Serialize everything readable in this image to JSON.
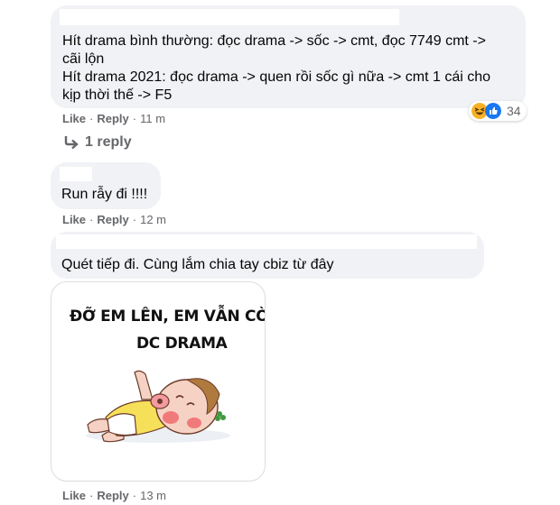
{
  "comments": [
    {
      "lines": [
        "Hít drama bình thường: đọc drama -> sốc -> cmt, đọc 7749 cmt ->",
        "cãi lộn",
        "Hít drama 2021: đọc drama -> quen rồi sốc gì nữa -> cmt 1 cái cho",
        "kịp thời thế -> F5"
      ],
      "like_label": "Like",
      "reply_label": "Reply",
      "time": "11 m",
      "reaction_count": "34"
    },
    {
      "text": "Run rẫy đi !!!!",
      "like_label": "Like",
      "reply_label": "Reply",
      "time": "12 m"
    },
    {
      "text": "Quét tiếp đi. Cùng lắm chia tay cbiz từ đây",
      "like_label": "Like",
      "reply_label": "Reply",
      "time": "13 m"
    }
  ],
  "replies_link": "1 reply",
  "separator": "·",
  "sticker": {
    "line1": "ĐỠ EM LÊN, EM VẪN CÒN HÍT",
    "line2": "DC DRAMA"
  },
  "colors": {
    "bubble": "#f0f2f5",
    "meta": "#65676b",
    "haha": "#f7b125",
    "like": "#1877f2"
  }
}
